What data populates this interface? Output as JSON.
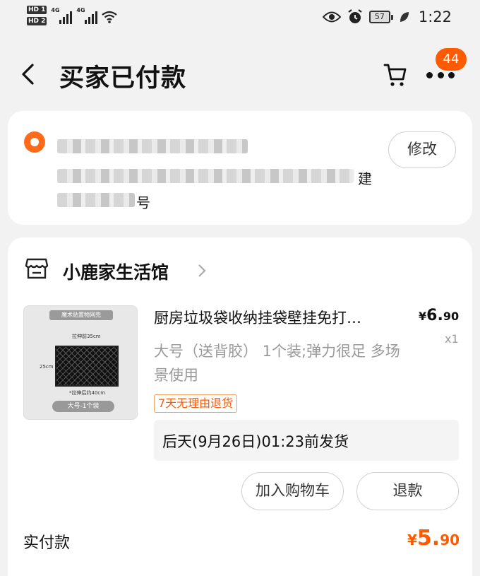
{
  "status_bar": {
    "sim1": "HD 1",
    "sim2": "HD 2",
    "network1": "4G",
    "network2": "4G",
    "battery": "57",
    "time": "1:22"
  },
  "header": {
    "title": "买家已付款",
    "notification_count": "44"
  },
  "address": {
    "edit_label": "修改",
    "visible_fragment_1": "建",
    "visible_fragment_2": "号"
  },
  "store": {
    "name": "小鹿家生活馆"
  },
  "product": {
    "title": "厨房垃圾袋收纳挂袋壁挂免打…",
    "price_symbol": "¥",
    "price_int": "6.",
    "price_dec": "90",
    "quantity": "x1",
    "sku": "大号（送背胶） 1个装;弹力很足 多场景使用",
    "return_policy": "7天无理由退货",
    "image": {
      "banner": "魔术贴置物网兜",
      "top_label": "拉伸前35cm",
      "side_label": "25cm",
      "bottom_label": "*拉伸后约40cm",
      "pill": "大号-1个装"
    }
  },
  "shipping": {
    "text": "后天(9月26日)01:23前发货"
  },
  "actions": {
    "add_to_cart": "加入购物车",
    "refund": "退款"
  },
  "payment": {
    "label": "实付款",
    "symbol": "¥",
    "int": "5.",
    "dec": "90"
  },
  "colors": {
    "accent": "#ff5a00",
    "background": "#f2f2f2",
    "card": "#ffffff"
  }
}
